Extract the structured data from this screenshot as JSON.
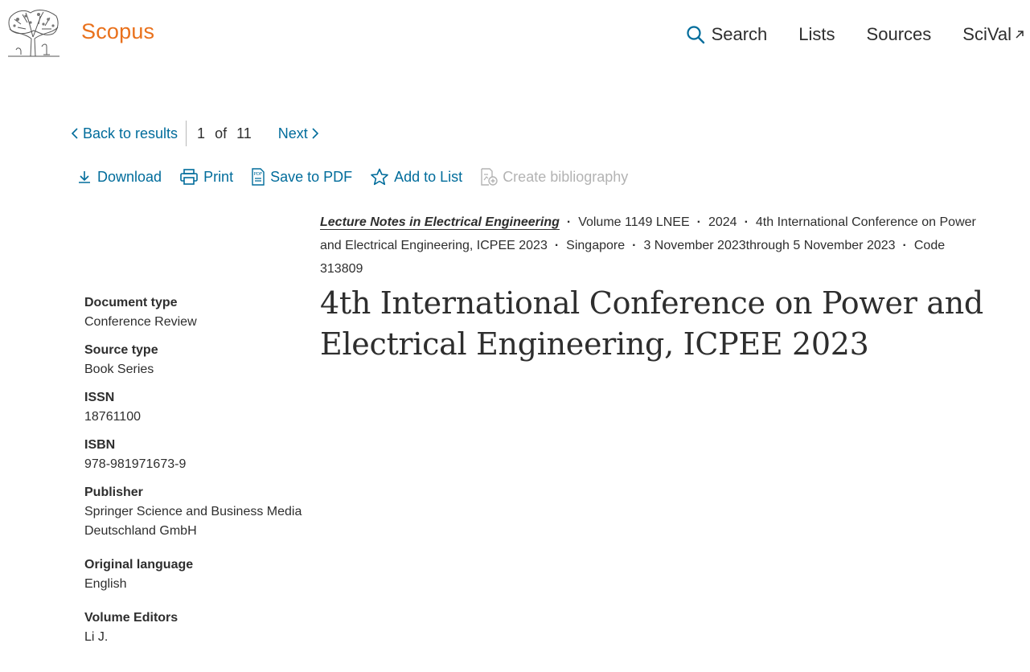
{
  "header": {
    "brand": "Scopus",
    "nav": {
      "search": "Search",
      "lists": "Lists",
      "sources": "Sources",
      "scival": "SciVal"
    }
  },
  "result_nav": {
    "back": "Back to results",
    "current": "1",
    "of": "of",
    "total": "11",
    "next": "Next"
  },
  "toolbar": {
    "download": "Download",
    "print": "Print",
    "save_pdf": "Save to PDF",
    "add_list": "Add to List",
    "create_bib": "Create bibliography"
  },
  "source": {
    "journal": "Lecture Notes in Electrical Engineering",
    "volume": "Volume 1149 LNEE",
    "year": "2024",
    "conference": "4th International Conference on Power and Electrical Engineering, ICPEE 2023",
    "location": "Singapore",
    "dates": "3 November 2023through 5 November 2023",
    "code": "Code 313809"
  },
  "document": {
    "title": "4th International Conference on Power and Electrical Engineering, ICPEE 2023"
  },
  "metadata": {
    "doc_type_label": "Document type",
    "doc_type_value": "Conference Review",
    "source_type_label": "Source type",
    "source_type_value": "Book Series",
    "issn_label": "ISSN",
    "issn_value": "18761100",
    "isbn_label": "ISBN",
    "isbn_value": "978-981971673-9",
    "publisher_label": "Publisher",
    "publisher_value": "Springer Science and Business Media Deutschland GmbH",
    "language_label": "Original language",
    "language_value": "English",
    "editors_label": "Volume Editors",
    "editors_value": "Li J."
  },
  "colors": {
    "brand": "#e9711c",
    "link": "#006c9b",
    "text": "#2e2e2e",
    "disabled": "#b3b3b3"
  },
  "icons": [
    "elsevier-tree-logo",
    "search-icon",
    "external-link-icon",
    "chevron-left-icon",
    "chevron-right-icon",
    "download-icon",
    "print-icon",
    "pdf-icon",
    "star-icon",
    "bibliography-icon"
  ]
}
